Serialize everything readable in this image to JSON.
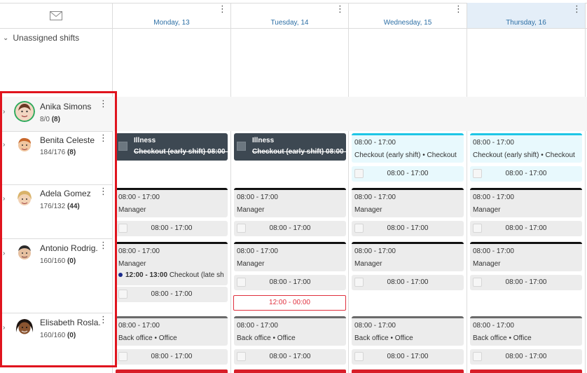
{
  "header": {
    "mail_icon": "envelope-icon",
    "days": [
      {
        "label": "Monday, 13",
        "today": false
      },
      {
        "label": "Tuesday, 14",
        "today": false
      },
      {
        "label": "Wednesday, 15",
        "today": false
      },
      {
        "label": "Thursday, 16",
        "today": true
      }
    ],
    "kebab": "⋮"
  },
  "unassigned": {
    "label": "Unassigned shifts"
  },
  "employees": [
    {
      "name": "Anika Simons",
      "hours": "8/0",
      "count": "(8)"
    },
    {
      "name": "Benita Celeste",
      "hours": "184/176",
      "count": "(8)"
    },
    {
      "name": "Adela Gomez",
      "hours": "176/132",
      "count": "(44)"
    },
    {
      "name": "Antonio Rodrig.",
      "hours": "160/160",
      "count": "(0)"
    },
    {
      "name": "Elisabeth Rosla.",
      "hours": "160/160",
      "count": "(0)"
    }
  ],
  "shifts": {
    "benita": {
      "mon": {
        "title": "Illness",
        "detail": "Checkout (early shift)   08:00 -"
      },
      "tue": {
        "title": "Illness",
        "detail": "Checkout (early shift)   08:00 -"
      },
      "wed": {
        "time": "08:00 - 17:00",
        "role": "Checkout (early shift) • Checkout",
        "sub": "08:00 - 17:00"
      },
      "thu": {
        "time": "08:00 - 17:00",
        "role": "Checkout (early shift) • Checkout",
        "sub": "08:00 - 17:00"
      }
    },
    "adela": {
      "time": "08:00 - 17:00",
      "role": "Manager",
      "sub": "08:00 - 17:00"
    },
    "antonio": {
      "time": "08:00 - 17:00",
      "role": "Manager",
      "sub": "08:00 - 17:00",
      "break_time": "12:00 - 13:00",
      "break_label": "Checkout (late sh",
      "red_shift": "12:00 - 00:00"
    },
    "elisabeth": {
      "time": "08:00 - 17:00",
      "role": "Back office • Office",
      "sub": "08:00 - 17:00"
    }
  },
  "colors": {
    "accent_blue": "#2d6fa5",
    "highlight_red": "#e0141e",
    "cyan": "#1ec6e6",
    "dark_card": "#3d4852"
  }
}
